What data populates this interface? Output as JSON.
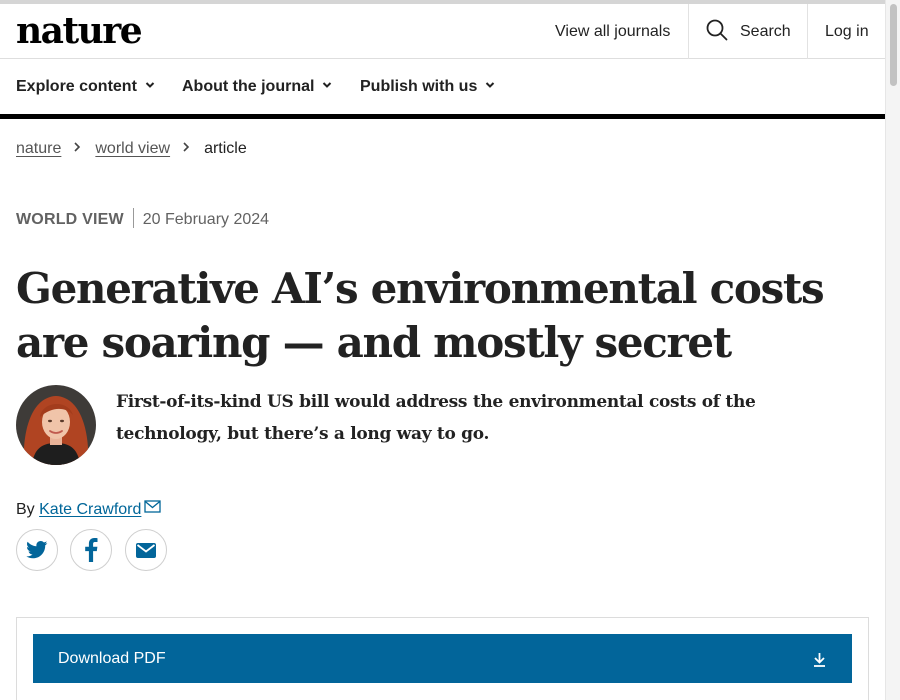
{
  "header": {
    "logo": "nature",
    "view_all_journals": "View all journals",
    "search_label": "Search",
    "login_label": "Log in"
  },
  "nav": {
    "items": [
      {
        "label": "Explore content"
      },
      {
        "label": "About the journal"
      },
      {
        "label": "Publish with us"
      }
    ]
  },
  "breadcrumb": {
    "items": [
      {
        "label": "nature"
      },
      {
        "label": "world view"
      },
      {
        "label": "article"
      }
    ]
  },
  "article": {
    "type": "World View",
    "date": "20 February 2024",
    "title": "Generative AI’s environmental costs are soaring — and mostly secret",
    "standfirst": "First-of-its-kind US bill would address the environmental costs of the technology, but there’s a long way to go.",
    "byline_prefix": "By",
    "author": "Kate Crawford"
  },
  "share": {
    "icons": [
      "twitter-icon",
      "facebook-icon",
      "email-icon"
    ]
  },
  "download": {
    "label": "Download PDF",
    "color": "#02659a"
  },
  "colors": {
    "link": "#006699",
    "accent": "#02659a",
    "text": "#222222"
  }
}
